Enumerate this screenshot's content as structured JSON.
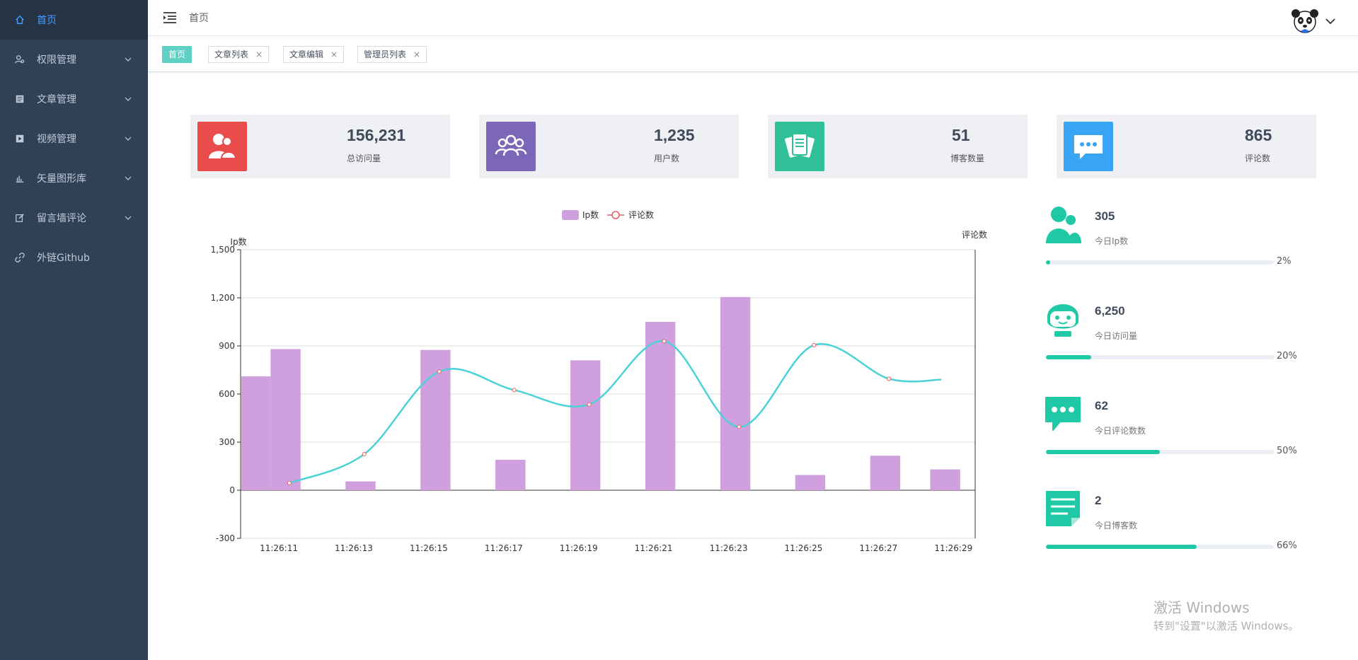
{
  "sidebar": {
    "items": [
      {
        "label": "首页",
        "icon": "home-icon",
        "active": true
      },
      {
        "label": "权限管理",
        "icon": "user-key-icon"
      },
      {
        "label": "文章管理",
        "icon": "document-icon"
      },
      {
        "label": "视频管理",
        "icon": "video-icon"
      },
      {
        "label": "矢量图形库",
        "icon": "bar-chart-icon"
      },
      {
        "label": "留言墙评论",
        "icon": "edit-icon"
      },
      {
        "label": "外链Github",
        "icon": "link-icon"
      }
    ]
  },
  "navbar": {
    "breadcrumb": "首页"
  },
  "tags": {
    "items": [
      {
        "label": "首页",
        "active": true
      },
      {
        "label": "文章列表"
      },
      {
        "label": "文章编辑"
      },
      {
        "label": "管理员列表"
      }
    ],
    "close_glyph": "×"
  },
  "cards": [
    {
      "value": "156,231",
      "label": "总访问量",
      "color": "#e84c4c",
      "icon": "people-icon"
    },
    {
      "value": "1,235",
      "label": "用户数",
      "color": "#7c66b8",
      "icon": "group-icon"
    },
    {
      "value": "51",
      "label": "博客数量",
      "color": "#2fc09a",
      "icon": "cards-icon"
    },
    {
      "value": "865",
      "label": "评论数",
      "color": "#3aa4f5",
      "icon": "chat-icon"
    }
  ],
  "chart_data": {
    "type": "bar",
    "legend": [
      "Ip数",
      "评论数"
    ],
    "legend_position": "top-center",
    "ylabel_left": "Ip数",
    "ylabel_right": "评论数",
    "categories": [
      "11:26:11",
      "11:26:13",
      "11:26:15",
      "11:26:17",
      "11:26:19",
      "11:26:21",
      "11:26:23",
      "11:26:25",
      "11:26:27",
      "11:26:29"
    ],
    "yticks": [
      1500,
      1200,
      900,
      600,
      300,
      0,
      -300
    ],
    "ytick_labels": [
      "1,500",
      "1,200",
      "900",
      "600",
      "300",
      "0",
      "-300"
    ],
    "ylim": [
      -300,
      1500
    ],
    "grid": true,
    "series": [
      {
        "name": "Ip数",
        "type": "bar",
        "color": "#d09fdd",
        "x": [
          10.7,
          11.5,
          13.5,
          15.5,
          17.5,
          19.5,
          21.5,
          23.5,
          25.5,
          27.5,
          29.1
        ],
        "values": [
          710,
          880,
          55,
          875,
          190,
          810,
          1050,
          1205,
          95,
          215,
          130
        ]
      },
      {
        "name": "评论数",
        "type": "line",
        "color": "#4ad2d6",
        "marker_color": "#e35c5c",
        "x": [
          11.6,
          13.6,
          15.6,
          17.6,
          19.6,
          21.6,
          23.6,
          25.6,
          27.6,
          29.0
        ],
        "values": [
          45,
          225,
          740,
          625,
          535,
          930,
          395,
          905,
          695,
          690
        ]
      }
    ]
  },
  "right_stats": [
    {
      "value": "305",
      "label": "今日Ip数",
      "pct_label": "2%",
      "pct": 2,
      "icon": "people-icon"
    },
    {
      "value": "6,250",
      "label": "今日访问量",
      "pct_label": "20%",
      "pct": 20,
      "icon": "robot-face-icon"
    },
    {
      "value": "62",
      "label": "今日评论数数",
      "pct_label": "50%",
      "pct": 50,
      "icon": "chat-icon"
    },
    {
      "value": "2",
      "label": "今日博客数",
      "pct_label": "66%",
      "pct": 66,
      "icon": "note-icon"
    }
  ],
  "watermark": {
    "line1": "激活 Windows",
    "line2": "转到\"设置\"以激活 Windows。"
  }
}
